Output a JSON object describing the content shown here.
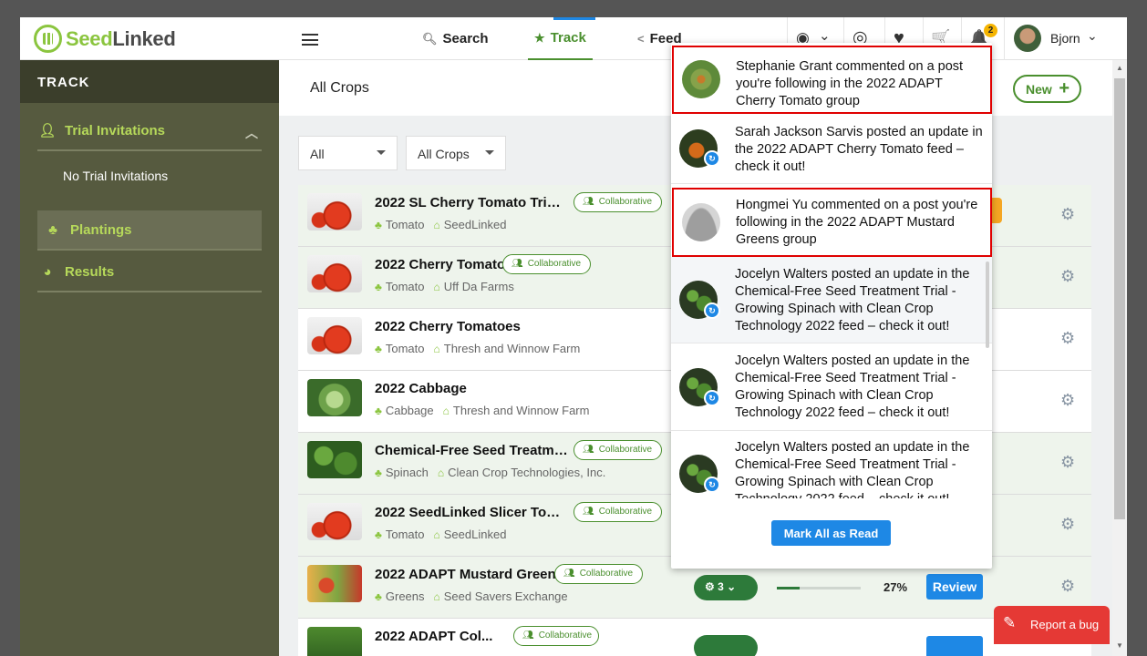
{
  "header": {
    "logo": {
      "part1": "Seed",
      "part2": "Linked"
    },
    "nav": {
      "search": "Search",
      "track": "Track",
      "feed": "Feed"
    },
    "icons": {
      "globe": "◉",
      "globe_caret": "⌄",
      "help": "◎",
      "heart": "♥",
      "cart": "🛒",
      "bell": "🔔"
    },
    "notification_count": "2",
    "user_name": "Bjorn"
  },
  "sidebar": {
    "title": "TRACK",
    "sections": [
      {
        "label": "Trial Invitations",
        "sub": "No Trial Invitations"
      },
      {
        "label": "Plantings"
      },
      {
        "label": "Results"
      }
    ]
  },
  "content": {
    "breadcrumb": "All Crops",
    "new_button": "New",
    "filters": {
      "status": "All",
      "crop": "All Crops"
    },
    "collab_label": "Collaborative",
    "rows": [
      {
        "title": "2022 SL Cherry Tomato Trial - ...",
        "crop": "Tomato",
        "org": "SeedLinked",
        "collaborative": true
      },
      {
        "title": "2022 Cherry Tomato",
        "crop": "Tomato",
        "org": "Uff Da Farms",
        "collaborative": true
      },
      {
        "title": "2022 Cherry Tomatoes",
        "crop": "Tomato",
        "org": "Thresh and Winnow Farm",
        "collaborative": false
      },
      {
        "title": "2022 Cabbage",
        "crop": "Cabbage",
        "org": "Thresh and Winnow Farm",
        "collaborative": false
      },
      {
        "title": "Chemical-Free Seed Treatmen...",
        "crop": "Spinach",
        "org": "Clean Crop Technologies, Inc.",
        "collaborative": true
      },
      {
        "title": "2022 SeedLinked Slicer Tomat...",
        "crop": "Tomato",
        "org": "SeedLinked",
        "collaborative": true
      },
      {
        "title": "2022 ADAPT Mustard Greens",
        "crop": "Greens",
        "org": "Seed Savers Exchange",
        "collaborative": true,
        "plantings": "3",
        "progress": "27%",
        "progress_value": 0.27,
        "action": "Review"
      },
      {
        "title": "2022 ADAPT Col...",
        "crop": "",
        "org": "",
        "collaborative": true
      }
    ]
  },
  "notifications": {
    "items": [
      {
        "text": "Stephanie Grant commented on a post you're following in the 2022 ADAPT Cherry Tomato group",
        "type": "comment",
        "highlighted": true
      },
      {
        "text": "Sarah Jackson Sarvis posted an update in the 2022 ADAPT Cherry Tomato feed – check it out!",
        "type": "update",
        "highlighted": false
      },
      {
        "text": "Hongmei Yu commented on a post you're following in the 2022 ADAPT Mustard Greens group",
        "type": "comment",
        "highlighted": true
      },
      {
        "text": "Jocelyn Walters posted an update in the Chemical-Free Seed Treatment Trial - Growing Spinach with Clean Crop Technology 2022 feed – check it out!",
        "type": "update",
        "highlighted": false
      },
      {
        "text": "Jocelyn Walters posted an update in the Chemical-Free Seed Treatment Trial - Growing Spinach with Clean Crop Technology 2022 feed – check it out!",
        "type": "update",
        "highlighted": false
      },
      {
        "text": "Jocelyn Walters posted an update in the Chemical-Free Seed Treatment Trial - Growing Spinach with Clean Crop Technology 2022 feed – check it out!",
        "type": "update",
        "highlighted": false
      }
    ],
    "mark_all": "Mark All as Read"
  },
  "report_bug": "Report a bug",
  "colors": {
    "brand_green": "#8bc53f",
    "dark_green": "#2d7a3a",
    "sidebar": "#565a3f",
    "primary_blue": "#1e88e5",
    "highlight_red": "#e00000",
    "bug_red": "#e53935"
  }
}
